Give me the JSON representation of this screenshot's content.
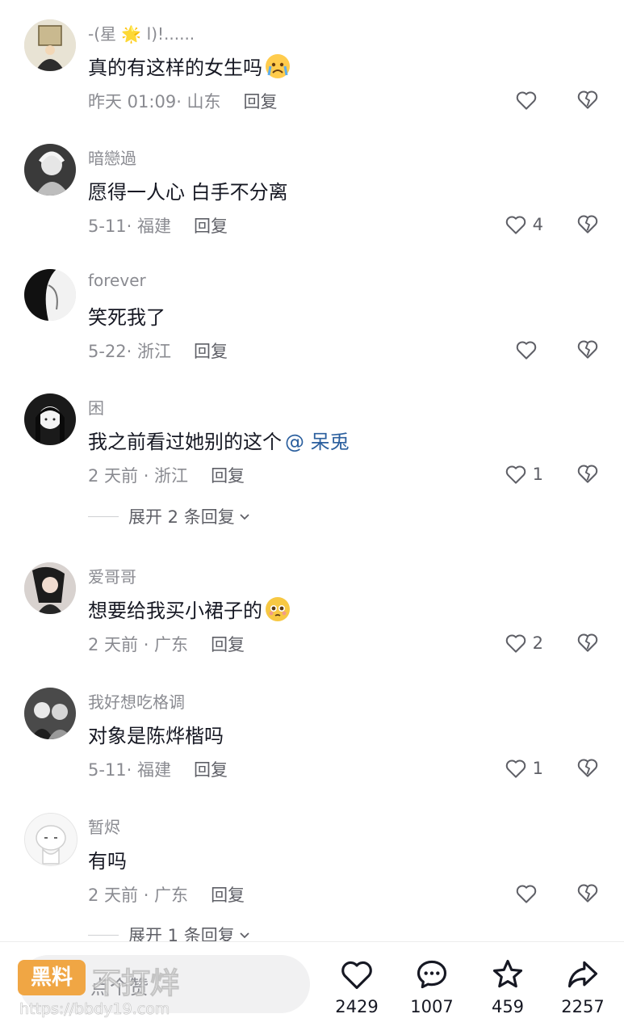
{
  "comments": [
    {
      "username": "-(星 🌟 l)!......",
      "text": "真的有这样的女生吗",
      "emoji": "crying-face-emoji",
      "meta": "昨天 01:09· 山东",
      "reply": "回复",
      "likes": ""
    },
    {
      "username": "暗戀過",
      "text": "愿得一人心 白手不分离",
      "meta": "5-11· 福建",
      "reply": "回复",
      "likes": "4"
    },
    {
      "username": "forever",
      "text": "笑死我了",
      "meta": "5-22· 浙江",
      "reply": "回复",
      "likes": ""
    },
    {
      "username": "困",
      "text": "我之前看过她别的这个",
      "mention": "@ 呆兎",
      "meta": "2 天前 · 浙江",
      "reply": "回复",
      "likes": "1",
      "expand": "展开 2 条回复"
    },
    {
      "username": "爱哥哥",
      "text": "想要给我买小裙子的",
      "emoji": "pleading-face-emoji",
      "meta": "2 天前 · 广东",
      "reply": "回复",
      "likes": "2"
    },
    {
      "username": "我好想吃格调",
      "text": "对象是陈烨楷吗",
      "meta": "5-11· 福建",
      "reply": "回复",
      "likes": "1"
    },
    {
      "username": "暂烬",
      "text": "有吗",
      "meta": "2 天前 · 广东",
      "reply": "回复",
      "likes": "",
      "expand": "展开 1 条回复"
    }
  ],
  "bottom_bar": {
    "input_text": "点个赞",
    "likes": "2429",
    "comments": "1007",
    "favorites": "459",
    "shares": "2257"
  },
  "watermark": {
    "badge": "黑料",
    "title": "不打烊",
    "url": "https://bbdy19.com"
  },
  "colors": {
    "mention": "#2b5f9e",
    "secondary_text": "#8a8b91",
    "watermark_badge": "#f0a23b"
  }
}
